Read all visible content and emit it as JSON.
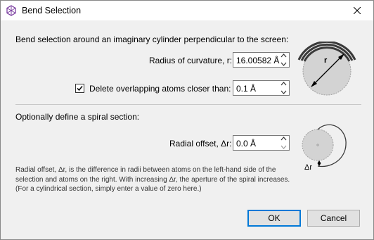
{
  "window": {
    "title": "Bend Selection"
  },
  "bend": {
    "heading": "Bend selection around an imaginary cylinder perpendicular to the screen:",
    "radius_label": "Radius of curvature, r:",
    "radius_value": "16.00582 Å",
    "delete_overlap_label": "Delete overlapping atoms closer than:",
    "delete_overlap_checked": true,
    "delete_overlap_value": "0.1 Å",
    "diagram_label": "r"
  },
  "spiral": {
    "heading": "Optionally define a spiral section:",
    "offset_label": "Radial offset, Δr:",
    "offset_value": "0.0 Å",
    "diagram_label": "Δr",
    "description": "Radial offset, Δr, is the difference in radii between atoms on the left-hand side of the selection and atoms on the right. With increasing Δr, the aperture of the spiral increases. (For a cylindrical section, simply enter a value of zero here.)"
  },
  "buttons": {
    "ok": "OK",
    "cancel": "Cancel"
  },
  "colors": {
    "accent": "#0078d7",
    "app_icon": "#7b3fa0"
  },
  "icons": {
    "app": "crystal-lattice-icon",
    "close": "close-icon"
  }
}
